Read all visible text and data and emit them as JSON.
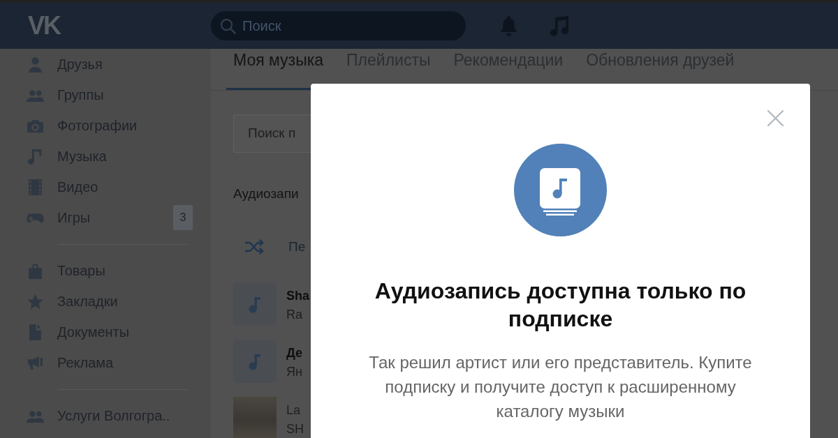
{
  "header": {
    "logo": "VK",
    "search": {
      "placeholder": "Поиск"
    }
  },
  "sidebar": {
    "groups": [
      {
        "items": [
          {
            "label": "Друзья"
          },
          {
            "label": "Группы"
          },
          {
            "label": "Фотографии"
          },
          {
            "label": "Музыка"
          },
          {
            "label": "Видео"
          },
          {
            "label": "Игры",
            "badge": "3"
          }
        ]
      },
      {
        "items": [
          {
            "label": "Товары"
          },
          {
            "label": "Закладки"
          },
          {
            "label": "Документы"
          },
          {
            "label": "Реклама"
          }
        ]
      },
      {
        "items": [
          {
            "label": "Услуги Волгогра.."
          }
        ]
      }
    ]
  },
  "music": {
    "tabs": [
      {
        "label": "Моя музыка",
        "selected": true
      },
      {
        "label": "Плейлисты",
        "selected": false
      },
      {
        "label": "Рекомендации",
        "selected": false
      },
      {
        "label": "Обновления друзей",
        "selected": false
      }
    ],
    "search": {
      "placeholder": "Поиск п"
    },
    "section_title": "Аудиозапи",
    "shuffle": {
      "label": "Пе"
    },
    "tracks": [
      {
        "kind": "placeholder",
        "title": "Sha",
        "artist": "Ra",
        "disabled": false
      },
      {
        "kind": "placeholder",
        "title": "Де",
        "artist": "Ян",
        "disabled": false
      },
      {
        "kind": "photo",
        "title": "La",
        "artist": "SH",
        "disabled": true
      }
    ]
  },
  "modal": {
    "title": "Аудиозапись доступна только по подписке",
    "text": "Так решил артист или его представитель. Купите подписку и получите доступ к расширенному каталогу музыки"
  }
}
